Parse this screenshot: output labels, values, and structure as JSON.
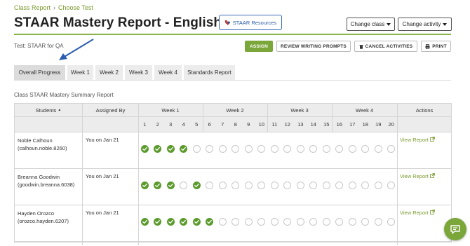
{
  "breadcrumb": {
    "items": [
      "Class Report",
      "Choose Test"
    ],
    "separator": "›"
  },
  "header": {
    "title": "STAAR Mastery Report - English 3a",
    "resources_label": "STAAR Resources",
    "change_class_label": "Change class",
    "change_activity_label": "Change activity"
  },
  "test_label": "Test: STAAR for QA",
  "actions": {
    "assign": "ASSIGN",
    "review": "REVIEW WRITING PROMPTS",
    "cancel": "CANCEL ACTIVITIES",
    "print": "PRINT"
  },
  "tabs": [
    "Overall Progress",
    "Week 1",
    "Week 2",
    "Week 3",
    "Week 4",
    "Standards Report"
  ],
  "active_tab": "Overall Progress",
  "section_title": "Class STAAR Mastery Summary Report",
  "table": {
    "col_students": "Students",
    "sort_indicator": "▲",
    "col_assigned": "Assigned By",
    "weeks": [
      "Week 1",
      "Week 2",
      "Week 3",
      "Week 4"
    ],
    "col_actions": "Actions",
    "lesson_numbers": [
      "1",
      "2",
      "3",
      "4",
      "5",
      "6",
      "7",
      "8",
      "9",
      "10",
      "11",
      "12",
      "13",
      "14",
      "15",
      "16",
      "17",
      "18",
      "19",
      "20"
    ],
    "rows": [
      {
        "name": "Noble Calhoun",
        "username": "(calhoun.noble.8260)",
        "assigned_by": "You on Jan 21",
        "completed": [
          1,
          2,
          3,
          4
        ],
        "report": "View Report"
      },
      {
        "name": "Breanna Goodwin",
        "username": "(goodwin.breanna.6038)",
        "assigned_by": "You on Jan 21",
        "completed": [
          1,
          2,
          3,
          5
        ],
        "report": "View Report"
      },
      {
        "name": "Hayden Orozco",
        "username": "(orozco.hayden.6207)",
        "assigned_by": "You on Jan 21",
        "completed": [
          1,
          2,
          3,
          4,
          5,
          6
        ],
        "report": "View Report"
      }
    ]
  },
  "colors": {
    "accent": "#7aa63a",
    "check": "#5b9a2c",
    "link": "#7a9a2e",
    "button_border": "#3b6bb8",
    "arrow": "#2a5db0"
  }
}
